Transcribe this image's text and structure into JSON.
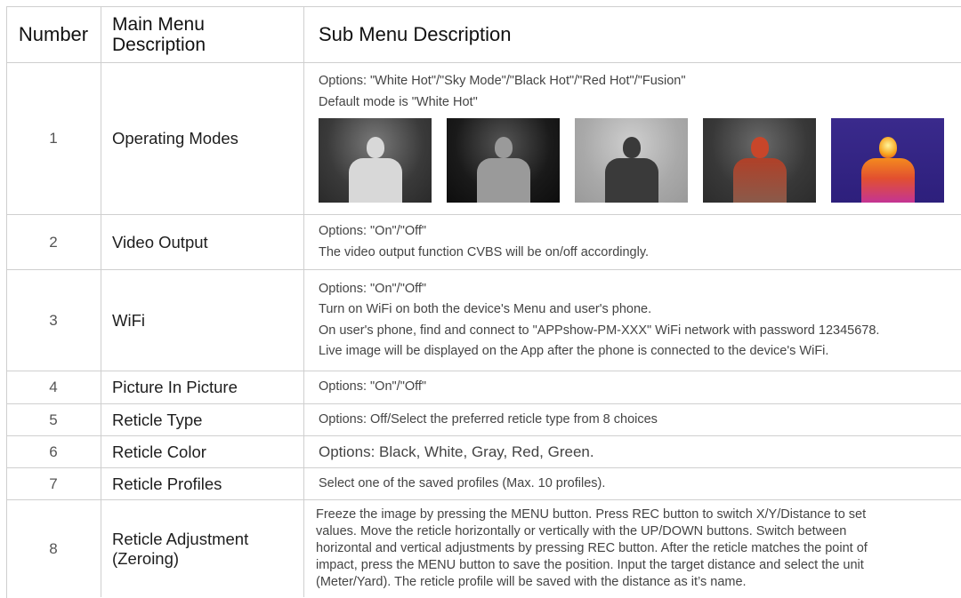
{
  "header": {
    "number": "Number",
    "main_line1": "Main Menu",
    "main_line2": "Description",
    "sub": "Sub Menu Description"
  },
  "rows": [
    {
      "number": "1",
      "main": "Operating Modes",
      "sub_lines": [
        "Options: \"White Hot\"/\"Sky Mode\"/\"Black Hot\"/\"Red Hot\"/\"Fusion\"",
        "Default mode is \"White Hot\""
      ],
      "images": [
        "white-hot-preview",
        "sky-mode-preview",
        "black-hot-preview",
        "red-hot-preview",
        "fusion-preview"
      ]
    },
    {
      "number": "2",
      "main": "Video Output",
      "sub_lines": [
        "Options: \"On\"/\"Off\"",
        "The video output function CVBS will be on/off accordingly."
      ]
    },
    {
      "number": "3",
      "main": "WiFi",
      "sub_lines": [
        "Options: \"On\"/\"Off\"",
        "Turn on WiFi on both the device's Menu and user's phone.",
        "On user's phone, find and connect to \"APPshow-PM-XXX\" WiFi network with password 12345678.",
        "Live image will be displayed on the App after the phone is connected to the device's WiFi."
      ]
    },
    {
      "number": "4",
      "main": "Picture In Picture",
      "sub_lines": [
        "Options: \"On\"/\"Off\""
      ]
    },
    {
      "number": "5",
      "main": "Reticle Type",
      "sub_lines": [
        "Options: Off/Select the preferred reticle type from 8 choices"
      ]
    },
    {
      "number": "6",
      "main": "Reticle Color",
      "sub_lines": [
        "Options: Black, White, Gray, Red, Green."
      ]
    },
    {
      "number": "7",
      "main": "Reticle Profiles",
      "sub_lines": [
        "Select one of the saved profiles (Max. 10 profiles)."
      ]
    },
    {
      "number": "8",
      "main_line1": "Reticle Adjustment",
      "main_line2": "(Zeroing)",
      "sub_lines": [
        "Freeze the image by pressing the MENU button. Press REC button to switch X/Y/Distance to set",
        "values. Move the reticle horizontally or vertically with the UP/DOWN buttons. Switch between",
        "horizontal and vertical adjustments by pressing REC button. After the reticle matches the point of",
        "impact, press the MENU button to save the position. Input the target distance and select the unit",
        "(Meter/Yard). The reticle profile will be saved with the distance as it’s name."
      ]
    }
  ]
}
